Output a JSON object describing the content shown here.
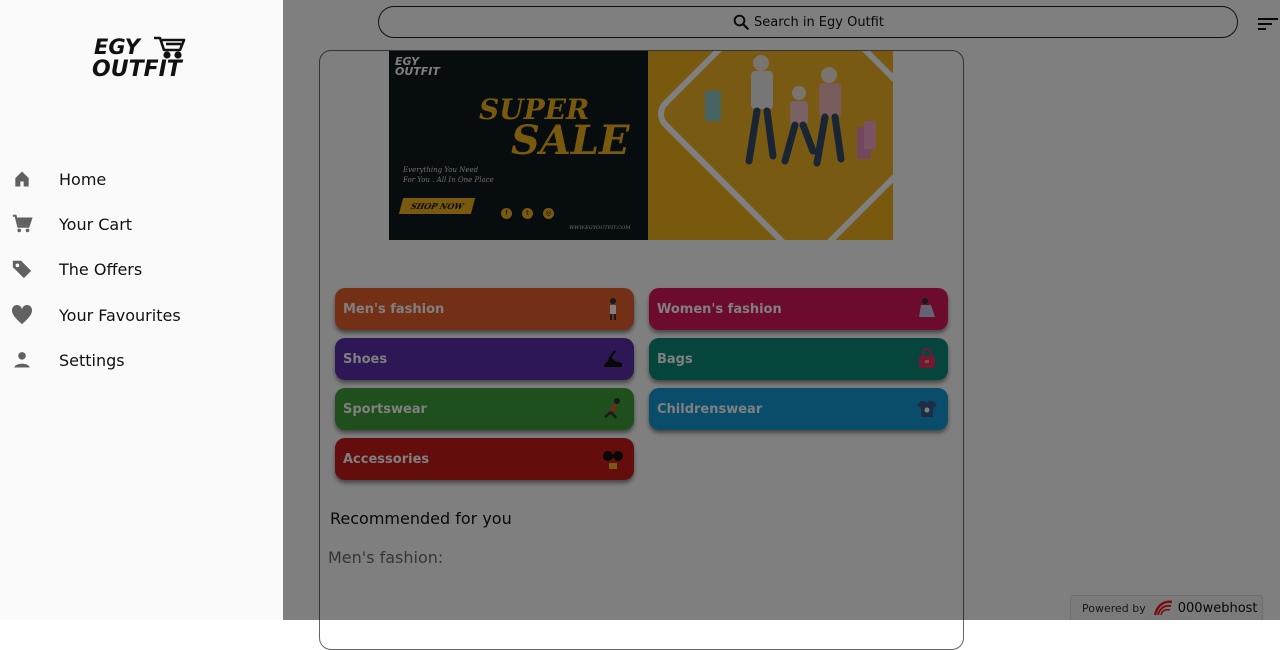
{
  "search": {
    "placeholder": "Search in Egy Outfit"
  },
  "banner": {
    "logo_line1": "EGY",
    "logo_line2": "OUTFIT",
    "headline1": "SUPER",
    "headline2": "SALE",
    "tagline_line1": "Everything You Need",
    "tagline_line2": "For You . All In One Place",
    "cta": "SHOP NOW",
    "url": "WWW.EGYOUTFIT.COM"
  },
  "categories": [
    {
      "label": "Men's fashion",
      "color": "#e8602c"
    },
    {
      "label": "Women's fashion",
      "color": "#d8175a"
    },
    {
      "label": "Shoes",
      "color": "#5a2ea8"
    },
    {
      "label": "Bags",
      "color": "#0d8a78"
    },
    {
      "label": "Sportswear",
      "color": "#3c9e3a"
    },
    {
      "label": "Childrenswear",
      "color": "#159ad6"
    },
    {
      "label": "Accessories",
      "color": "#c81b1b"
    }
  ],
  "sections": {
    "recommended": "Recommended for you",
    "first_section": "Men's fashion:"
  },
  "drawer": {
    "logo_line1": "EGY",
    "logo_line2": "OUTFIT",
    "items": [
      {
        "label": "Home",
        "icon": "home-icon"
      },
      {
        "label": "Your Cart",
        "icon": "cart-icon"
      },
      {
        "label": "The Offers",
        "icon": "tag-icon"
      },
      {
        "label": "Your Favourites",
        "icon": "heart-icon"
      },
      {
        "label": "Settings",
        "icon": "person-icon"
      }
    ]
  },
  "powered": {
    "prefix": "Powered by",
    "brand": "000webhost"
  },
  "colors": {
    "overlay": "rgba(0,0,0,0.5)",
    "banner_dark": "#0f1a1f",
    "banner_yellow": "#f0b21c"
  }
}
